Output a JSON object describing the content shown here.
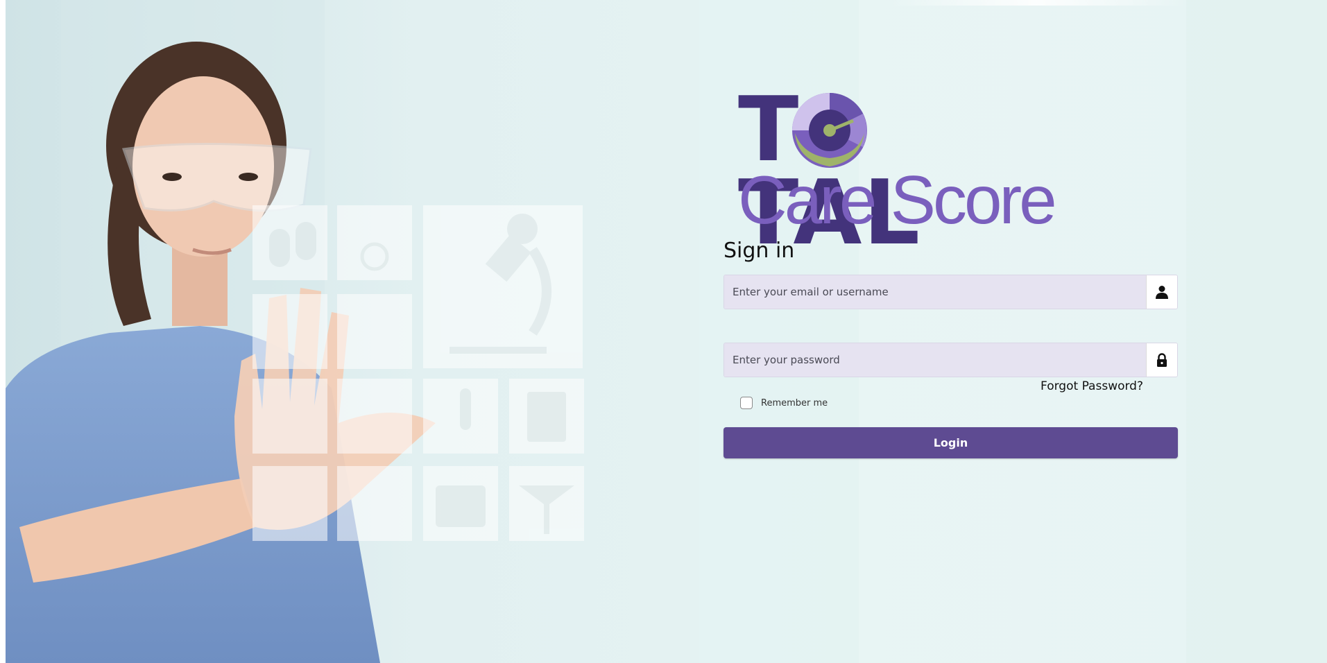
{
  "brand": {
    "logo_line1": "TOTAL",
    "logo_line2": "Care Score",
    "color_primary": "#43337b",
    "color_secondary": "#7a5fbd",
    "color_accent": "#9fb36a"
  },
  "signin": {
    "title": "Sign in",
    "username_placeholder": "Enter your email or username",
    "password_placeholder": "Enter your password",
    "forgot_label": "Forgot Password?",
    "remember_label": "Remember me",
    "login_label": "Login",
    "button_color": "#5e4b92"
  },
  "icons": {
    "user": "user-icon",
    "lock": "lock-icon"
  }
}
